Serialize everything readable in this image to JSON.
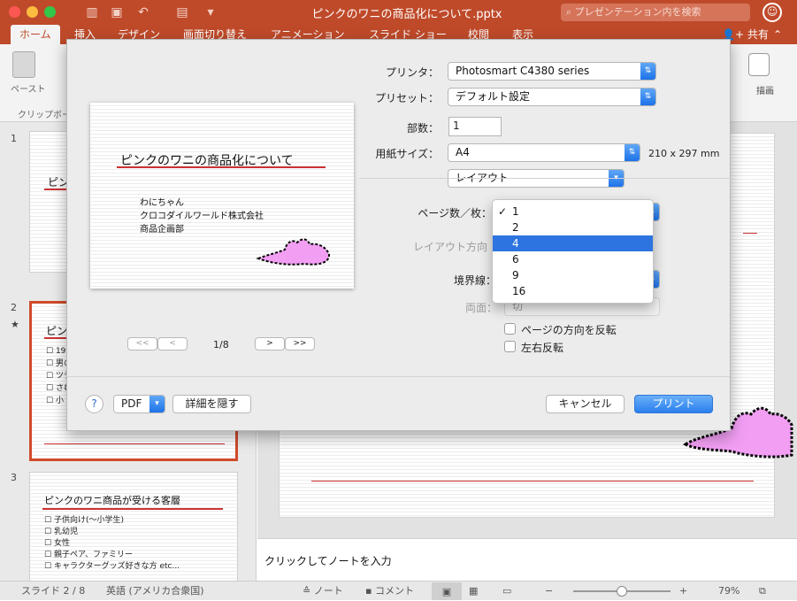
{
  "titlebar": {
    "title": "ピンクのワニの商品化について.pptx",
    "search_placeholder": "プレゼンテーション内を検索",
    "window_colors": {
      "close": "#fc5753",
      "min": "#fdbc40",
      "max": "#33c748"
    }
  },
  "tabs": [
    "ホーム",
    "挿入",
    "デザイン",
    "画面切り替え",
    "アニメーション",
    "スライド ショー",
    "校閲",
    "表示"
  ],
  "share_label": "共有",
  "ribbon": {
    "paste_label": "ペースト",
    "clipboard_label": "クリップボー",
    "draw_label": "描画"
  },
  "slides": [
    {
      "number": "1",
      "title": "ピンク"
    },
    {
      "number": "2",
      "title": "ピンク",
      "items": [
        "19",
        "男の",
        "ツテ",
        "さむ",
        "小"
      ]
    },
    {
      "number": "3",
      "title": "ピンクのワニ商品が受ける客層",
      "items": [
        "子供向け(〜小学生)",
        "乳幼児",
        "女性",
        "親子ペア、ファミリー",
        "キャラクターグッズ好きな方 etc..."
      ]
    }
  ],
  "notes_placeholder": "クリックしてノートを入力",
  "status": {
    "slide_count": "スライド 2 / 8",
    "language": "英語 (アメリカ合衆国)",
    "notes_label": "ノート",
    "comments_label": "コメント",
    "zoom": "79%",
    "zoom_level": 0.5
  },
  "print_dialog": {
    "preview": {
      "title": "ピンクのワニの商品化について",
      "author": "わにちゃん",
      "company": "クロコダイルワールド株式会社",
      "department": "商品企画部",
      "page": "1/8"
    },
    "printer_label": "プリンタ：",
    "printer": "Photosmart C4380 series",
    "preset_label": "プリセット：",
    "preset": "デフォルト設定",
    "copies_label": "部数：",
    "copies": "1",
    "paper_label": "用紙サイズ：",
    "paper": "A4",
    "paper_dims": "210 x 297 mm",
    "section": "レイアウト",
    "pages_per_sheet_label": "ページ数／枚：",
    "layout_dir_label": "レイアウト方向",
    "border_label": "境界線：",
    "duplex_label": "両面：",
    "duplex": "切",
    "reverse_orientation": "ページの方向を反転",
    "flip_horizontal": "左右反転",
    "pages_per_sheet_options": [
      "1",
      "2",
      "4",
      "6",
      "9",
      "16"
    ],
    "selected_option": "4",
    "checked_option": "1",
    "nav": {
      "first": "<<",
      "prev": "<",
      "next": ">",
      "last": ">>"
    },
    "help": "?",
    "pdf": "PDF",
    "hide_details": "詳細を隠す",
    "cancel": "キャンセル",
    "print": "プリント"
  }
}
